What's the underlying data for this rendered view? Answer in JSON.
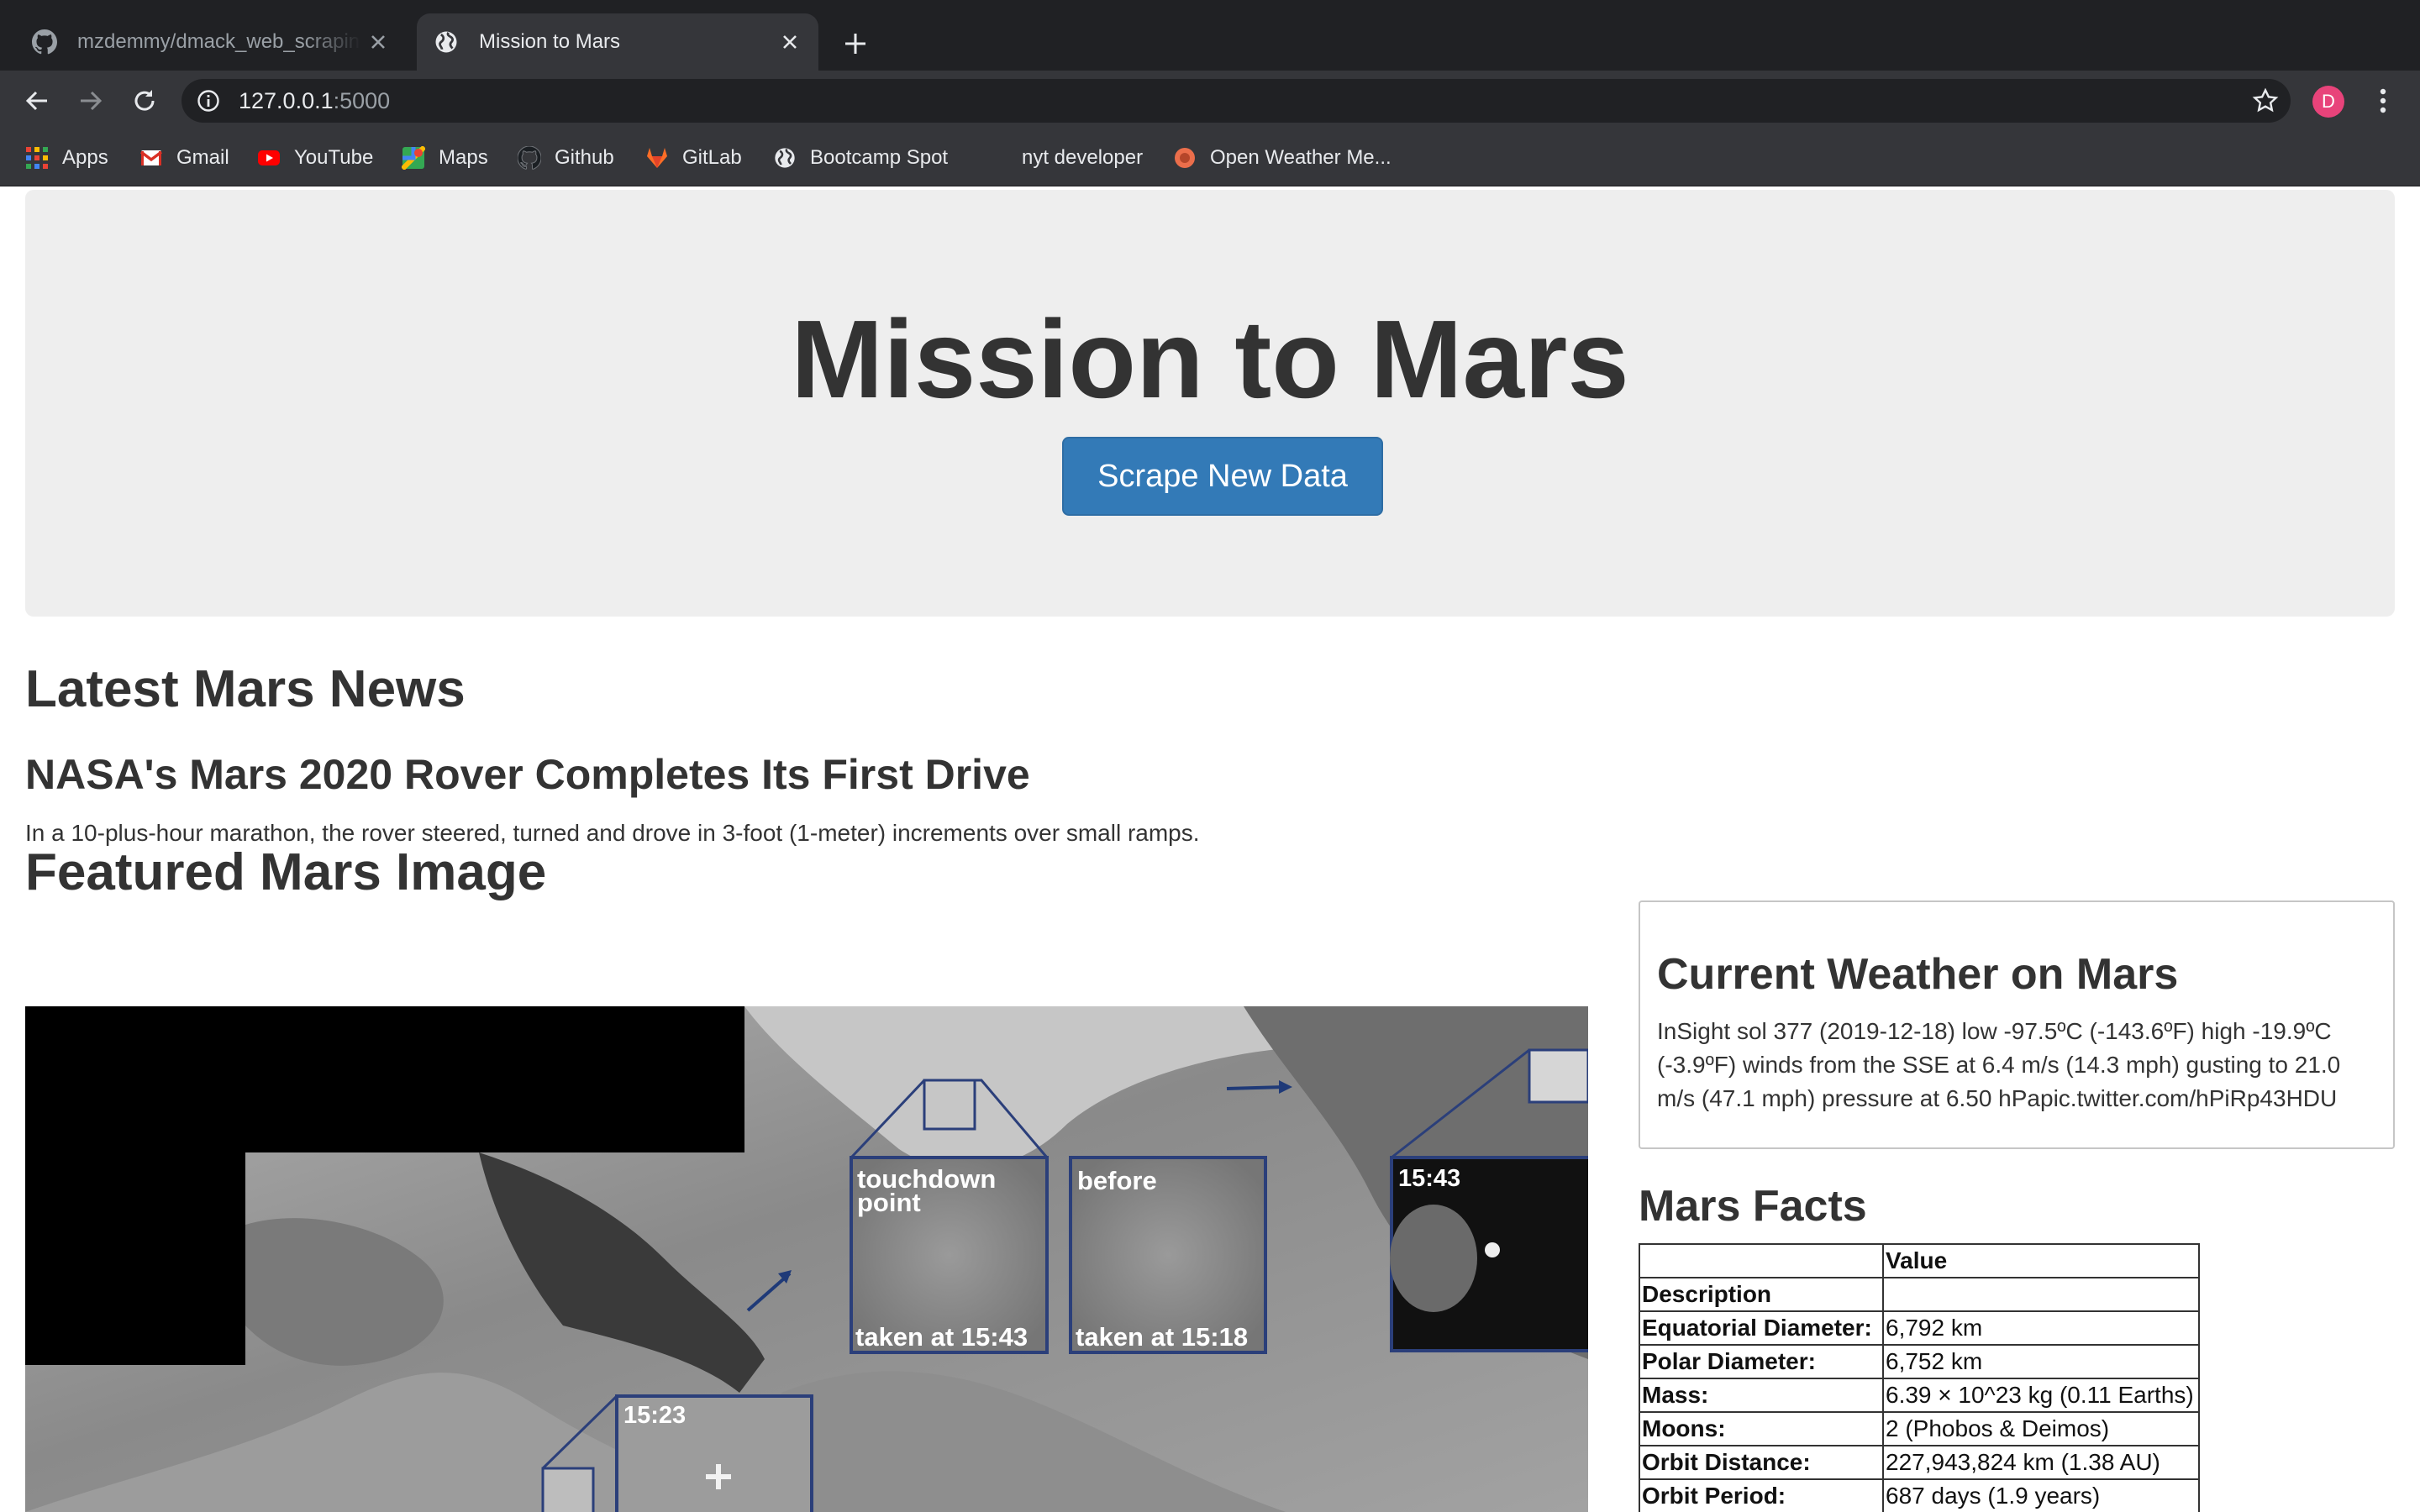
{
  "browser": {
    "tabs": [
      {
        "title": "mzdemmy/dmack_web_scraping",
        "icon": "github-icon",
        "active": false
      },
      {
        "title": "Mission to Mars",
        "icon": "globe-icon",
        "active": true
      }
    ],
    "url_host": "127.0.0.1",
    "url_port": ":5000",
    "profile_initial": "D",
    "bookmarks": [
      {
        "label": "Apps",
        "icon": "apps-grid-icon"
      },
      {
        "label": "Gmail",
        "icon": "gmail-icon"
      },
      {
        "label": "YouTube",
        "icon": "youtube-icon"
      },
      {
        "label": "Maps",
        "icon": "maps-icon"
      },
      {
        "label": "Github",
        "icon": "github-icon"
      },
      {
        "label": "GitLab",
        "icon": "gitlab-icon"
      },
      {
        "label": "Bootcamp Spot",
        "icon": "globe-icon"
      },
      {
        "label": "nyt developer",
        "icon": ""
      },
      {
        "label": "Open Weather Me...",
        "icon": "openweather-icon"
      }
    ]
  },
  "page": {
    "title": "Mission to Mars",
    "scrape_button": "Scrape New Data",
    "news": {
      "heading": "Latest Mars News",
      "title": "NASA's Mars 2020 Rover Completes Its First Drive",
      "paragraph": "In a 10-plus-hour marathon, the rover steered, turned and drove in 3-foot (1-meter) increments over small ramps."
    },
    "featured": {
      "heading": "Featured Mars Image",
      "image_labels": {
        "touchdown": "touchdown point",
        "touchdown_line1": "touchdown",
        "touchdown_line2": "point",
        "before": "before",
        "taken_1543": "taken at 15:43",
        "taken_1518": "taken at 15:18",
        "time_1543": "15:43",
        "time_1523": "15:23"
      }
    },
    "weather": {
      "heading": "Current Weather on Mars",
      "text": "InSight sol 377 (2019-12-18) low -97.5ºC (-143.6ºF) high -19.9ºC (-3.9ºF) winds from the SSE at 6.4 m/s (14.3 mph) gusting to 21.0 m/s (47.1 mph) pressure at 6.50 hPapic.twitter.com/hPiRp43HDU"
    },
    "facts": {
      "heading": "Mars Facts",
      "header_value": "Value",
      "rows": [
        {
          "label": "Description",
          "value": ""
        },
        {
          "label": "Equatorial Diameter:",
          "value": "6,792 km"
        },
        {
          "label": "Polar Diameter:",
          "value": "6,752 km"
        },
        {
          "label": "Mass:",
          "value": "6.39 × 10^23 kg (0.11 Earths)"
        },
        {
          "label": "Moons:",
          "value": "2 (Phobos & Deimos)"
        },
        {
          "label": "Orbit Distance:",
          "value": "227,943,824 km (1.38 AU)"
        },
        {
          "label": "Orbit Period:",
          "value": "687 days (1.9 years)"
        }
      ]
    }
  },
  "colors": {
    "tabstrip": "#202124",
    "toolbar": "#35363a",
    "jumbotron": "#eeeeee",
    "button": "#337ab7",
    "avatar": "#e8437a",
    "overlay_frame": "#2b3f7a"
  }
}
